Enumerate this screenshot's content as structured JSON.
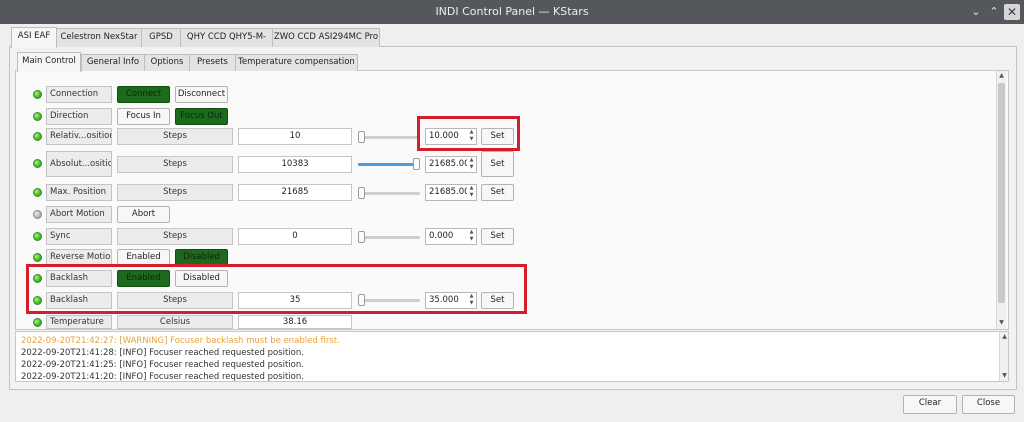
{
  "window": {
    "title": "INDI Control Panel — KStars",
    "controls": [
      "⌄",
      "⌃",
      "✕"
    ]
  },
  "device_tabs": [
    "ASI EAF",
    "Celestron NexStar",
    "GPSD",
    "QHY CCD QHY5-M-",
    "ZWO CCD ASI294MC Pro"
  ],
  "group_tabs": [
    "Main Control",
    "General Info",
    "Options",
    "Presets",
    "Temperature compensation"
  ],
  "rows": {
    "connection": {
      "label": "Connection",
      "connect": "Connect",
      "disconnect": "Disconnect"
    },
    "direction": {
      "label": "Direction",
      "focus_in": "Focus In",
      "focus_out": "Focus Out"
    },
    "relative": {
      "label": "Relativ...osition",
      "unit": "Steps",
      "value": "10",
      "spin": "10.000",
      "set": "Set",
      "slider_fraction": 0
    },
    "absolute": {
      "label": "Absolut...osition",
      "unit": "Steps",
      "value": "10383",
      "spin": "21685.00(",
      "set": "Set",
      "slider_fraction": 1
    },
    "max_position": {
      "label": "Max. Position",
      "unit": "Steps",
      "value": "21685",
      "spin": "21685.00(",
      "set": "Set",
      "slider_fraction": 0
    },
    "abort": {
      "label": "Abort Motion",
      "abort": "Abort"
    },
    "sync": {
      "label": "Sync",
      "unit": "Steps",
      "value": "0",
      "spin": "0.000",
      "set": "Set",
      "slider_fraction": 0
    },
    "reverse": {
      "label": "Reverse Motion",
      "enabled": "Enabled",
      "disabled": "Disabled"
    },
    "backlash_switch": {
      "label": "Backlash",
      "enabled": "Enabled",
      "disabled": "Disabled"
    },
    "backlash_steps": {
      "label": "Backlash",
      "unit": "Steps",
      "value": "35",
      "spin": "35.000",
      "set": "Set",
      "slider_fraction": 0
    },
    "temperature": {
      "label": "Temperature",
      "unit": "Celsius",
      "value": "38.16"
    }
  },
  "log": [
    {
      "text": "2022-09-20T21:42:27: [WARNING] Focuser backlash must be enabled first.",
      "color": "#e8a33a"
    },
    {
      "text": "2022-09-20T21:41:28: [INFO] Focuser reached requested position.",
      "color": "#333333"
    },
    {
      "text": "2022-09-20T21:41:25: [INFO] Focuser reached requested position.",
      "color": "#333333"
    },
    {
      "text": "2022-09-20T21:41:20: [INFO] Focuser reached requested position.",
      "color": "#333333"
    }
  ],
  "footer": {
    "clear": "Clear",
    "close": "Close"
  },
  "colors": {
    "active_button": "#1c6b1c",
    "highlight": "#d41f2a",
    "warning": "#e8a33a",
    "titlebar": "#54585c"
  }
}
